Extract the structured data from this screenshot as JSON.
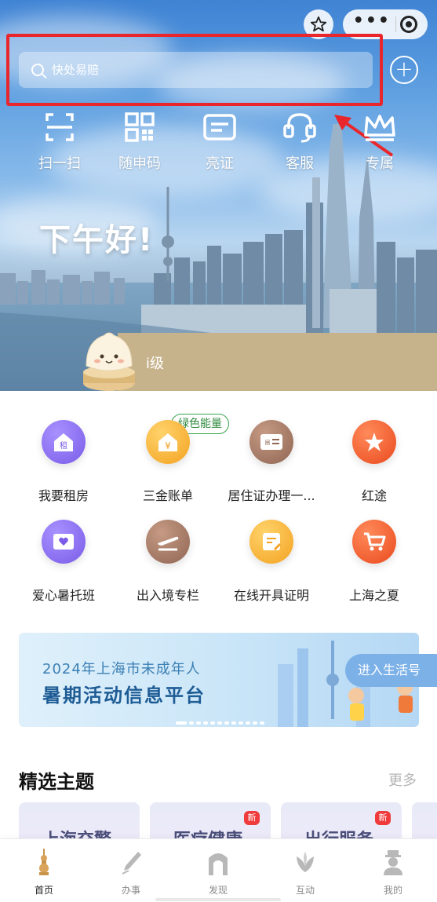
{
  "hero": {
    "greeting": "下午好!",
    "level_text": "i级",
    "search_placeholder": "快处易赔",
    "quick_actions": [
      {
        "icon": "scan-icon",
        "label": "扫一扫"
      },
      {
        "icon": "qr-code-icon",
        "label": "随申码"
      },
      {
        "icon": "id-card-icon",
        "label": "亮证"
      },
      {
        "icon": "customer-service-icon",
        "label": "客服"
      },
      {
        "icon": "crown-icon",
        "label": "专属"
      }
    ]
  },
  "topbar": {
    "star_icon": "star-icon",
    "more_icon": "more-dots-icon",
    "close_icon": "miniprogram-close-icon",
    "add_icon": "add-circle-icon"
  },
  "services": {
    "badge": "绿色能量",
    "items": [
      {
        "label": "我要租房",
        "icon": "rent-house-icon",
        "color": "#8a6ef0"
      },
      {
        "label": "三金账单",
        "icon": "fund-bill-icon",
        "color": "#f7a930"
      },
      {
        "label": "居住证办理一...",
        "icon": "residence-card-icon",
        "color": "#a87860"
      },
      {
        "label": "红途",
        "icon": "red-route-icon",
        "color": "#f15a2b"
      },
      {
        "label": "爱心暑托班",
        "icon": "summer-class-icon",
        "color": "#8a6ef0"
      },
      {
        "label": "出入境专栏",
        "icon": "airplane-icon",
        "color": "#a87860"
      },
      {
        "label": "在线开具证明",
        "icon": "certificate-icon",
        "color": "#f7a930"
      },
      {
        "label": "上海之夏",
        "icon": "shopping-cart-icon",
        "color": "#f15a2b"
      }
    ]
  },
  "banner": {
    "line1": "2024年上海市未成年人",
    "line2": "暑期活动信息平台",
    "side_button": "进入生活号"
  },
  "themes": {
    "title": "精选主题",
    "more": "更多",
    "cards": [
      {
        "label": "上海交警",
        "new": false
      },
      {
        "label": "医疗健康",
        "new": true,
        "badge": "新"
      },
      {
        "label": "出行服务",
        "new": true,
        "badge": "新"
      }
    ]
  },
  "tabbar": {
    "tabs": [
      {
        "label": "首页",
        "icon": "home-tower-icon",
        "active": true
      },
      {
        "label": "办事",
        "icon": "pen-icon",
        "active": false
      },
      {
        "label": "发现",
        "icon": "discover-icon",
        "active": false
      },
      {
        "label": "互动",
        "icon": "magnolia-icon",
        "active": false
      },
      {
        "label": "我的",
        "icon": "profile-icon",
        "active": false
      }
    ]
  }
}
